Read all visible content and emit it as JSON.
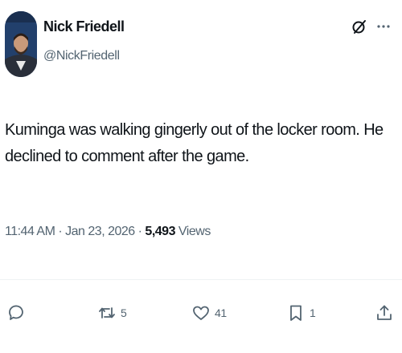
{
  "author": {
    "display_name": "Nick Friedell",
    "handle": "@NickFriedell"
  },
  "tweet": {
    "text": "Kuminga was walking gingerly out of the locker room. He declined to comment after the game.",
    "time": "11:44 AM",
    "date": "Jan 23, 2026",
    "separator": "·",
    "views_count": "5,493",
    "views_label": "Views"
  },
  "actions": {
    "reply_count": "",
    "repost_count": "5",
    "like_count": "41",
    "bookmark_count": "1"
  },
  "icons": {
    "grok": "grok-icon",
    "more": "more-icon",
    "reply": "reply-icon",
    "repost": "repost-icon",
    "like": "heart-icon",
    "bookmark": "bookmark-icon",
    "share": "share-icon"
  },
  "colors": {
    "text_primary": "#0f1419",
    "text_secondary": "#536471",
    "divider": "#eff3f4"
  }
}
